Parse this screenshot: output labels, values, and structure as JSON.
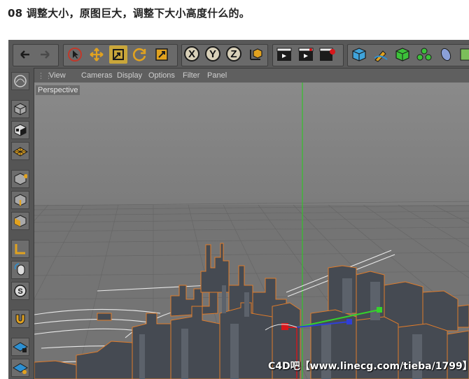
{
  "heading": "08 调整大小，原图巨大，调整下大小高度什么的。",
  "menu": {
    "items": [
      "View",
      "Cameras",
      "Display",
      "Options",
      "Filter",
      "Panel"
    ]
  },
  "viewport": {
    "label": "Perspective"
  },
  "toolbar": {
    "undo_icon": "undo-icon",
    "redo_icon": "redo-icon",
    "axes": [
      "X",
      "Y",
      "Z"
    ],
    "active_tool": "scale-tool"
  },
  "colors": {
    "axis_red": "#d6171b",
    "axis_green": "#35d22c",
    "axis_blue": "#2f3fd8",
    "selection_outline": "#e07c2a",
    "viewport_bg": "#878787"
  },
  "watermark": "C4D吧【www.linecg.com/tieba/1799】"
}
